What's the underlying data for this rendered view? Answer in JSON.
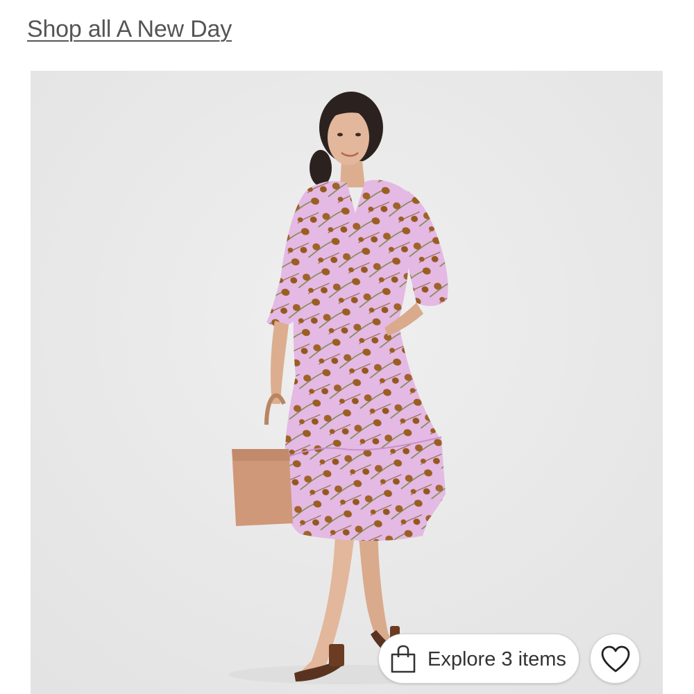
{
  "header": {
    "shop_link_label": "Shop all A New Day"
  },
  "product": {
    "image_icon": "product-photo",
    "background_color": "#eaeaeb",
    "dress_color": "#e2b6e2",
    "print_color": "#9a5e22"
  },
  "actions": {
    "explore_label": "Explore 3 items",
    "explore_icon": "shopping-bag-icon",
    "favorite_icon": "heart-icon"
  }
}
